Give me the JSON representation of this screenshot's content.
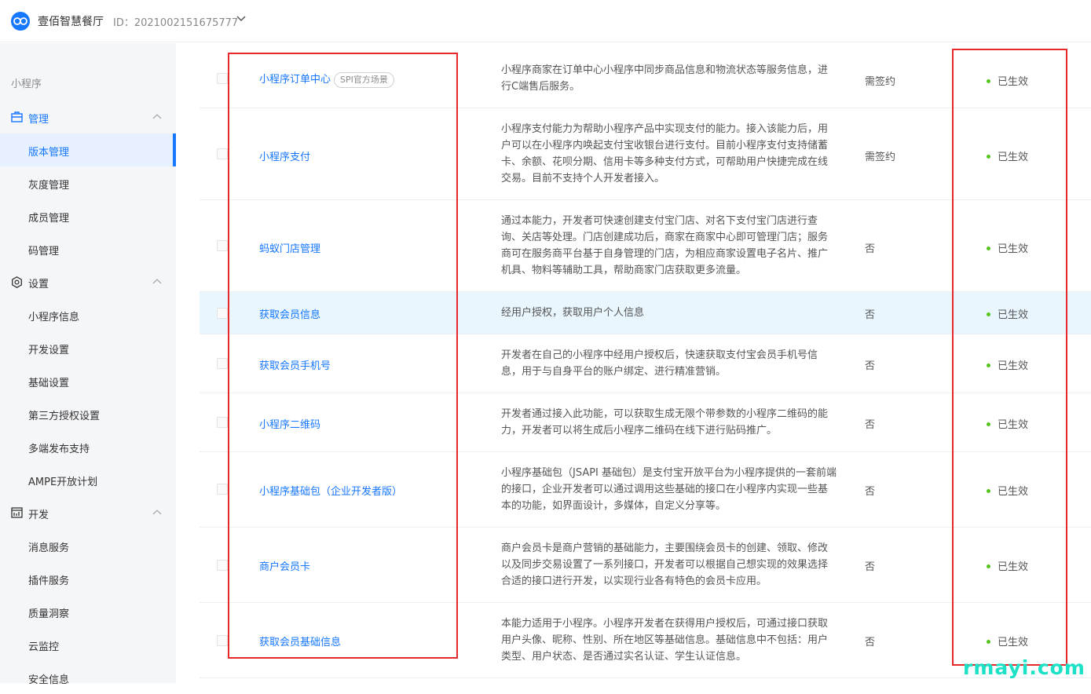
{
  "header": {
    "app_name": "壹佰智慧餐厅",
    "app_id": "ID：2021002151675777"
  },
  "sidebar": {
    "title": "小程序",
    "groups": [
      {
        "label": "管理",
        "icon": "briefcase-icon"
      },
      {
        "label": "设置",
        "icon": "gear-icon"
      },
      {
        "label": "开发",
        "icon": "code-window-icon"
      }
    ],
    "items": [
      "版本管理",
      "灰度管理",
      "成员管理",
      "码管理",
      "小程序信息",
      "开发设置",
      "基础设置",
      "第三方授权设置",
      "多端发布支持",
      "AMPE开放计划",
      "消息服务",
      "插件服务",
      "质量洞察",
      "云监控",
      "安全信息"
    ]
  },
  "table": {
    "rows": [
      {
        "name": "小程序订单中心",
        "tag": "SPI官方场景",
        "desc": "小程序商家在订单中心小程序中同步商品信息和物流状态等服务信息，进行C端售后服务。",
        "sign": "需签约",
        "status": "已生效"
      },
      {
        "name": "小程序支付",
        "desc": "小程序支付能力为帮助小程序产品中实现支付的能力。接入该能力后，用户可以在小程序内唤起支付宝收银台进行支付。目前小程序支付支持储蓄卡、余额、花呗分期、信用卡等多种支付方式，可帮助用户快捷完成在线交易。目前不支持个人开发者接入。",
        "sign": "需签约",
        "status": "已生效"
      },
      {
        "name": "蚂蚁门店管理",
        "desc": "通过本能力，开发者可快速创建支付宝门店、对名下支付宝门店进行查询、关店等处理。门店创建成功后，商家在商家中心即可管理门店；服务商可在服务商平台基于自身管理的门店，为相应商家设置电子名片、推广机具、物料等辅助工具，帮助商家门店获取更多流量。",
        "sign": "否",
        "status": "已生效"
      },
      {
        "name": "获取会员信息",
        "desc": "经用户授权，获取用户个人信息",
        "sign": "否",
        "status": "已生效"
      },
      {
        "name": "获取会员手机号",
        "desc": "开发者在自己的小程序中经用户授权后，快速获取支付宝会员手机号信息，用于与自身平台的账户绑定、进行精准营销。",
        "sign": "否",
        "status": "已生效"
      },
      {
        "name": "小程序二维码",
        "desc": "开发者通过接入此功能，可以获取生成无限个带参数的小程序二维码的能力，开发者可以将生成后小程序二维码在线下进行贴码推广。",
        "sign": "否",
        "status": "已生效"
      },
      {
        "name": "小程序基础包（企业开发者版）",
        "desc": "小程序基础包（JSAPI 基础包）是支付宝开放平台为小程序提供的一套前端的接口，企业开发者可以通过调用这些基础的接口在小程序内实现一些基本的功能，如界面设计，多媒体，自定义分享等。",
        "sign": "否",
        "status": "已生效"
      },
      {
        "name": "商户会员卡",
        "desc": "商户会员卡是商户营销的基础能力，主要围绕会员卡的创建、领取、修改以及同步交易设置了一系列接口，开发者可以根据自己想实现的效果选择合适的接口进行开发，以实现行业各有特色的会员卡应用。",
        "sign": "否",
        "status": "已生效"
      },
      {
        "name": "获取会员基础信息",
        "desc": "本能力适用于小程序。小程序开发者在获得用户授权后，可通过接口获取用户头像、昵称、性别、所在地区等基础信息。基础信息中不包括：用户类型、用户状态、是否通过实名认证、学生认证信息。",
        "sign": "否",
        "status": "已生效"
      }
    ]
  },
  "watermark": "rmayi.com",
  "colors": {
    "accent": "#1677ff",
    "status_dot": "#52c41a",
    "highlight": "#e8282b"
  }
}
